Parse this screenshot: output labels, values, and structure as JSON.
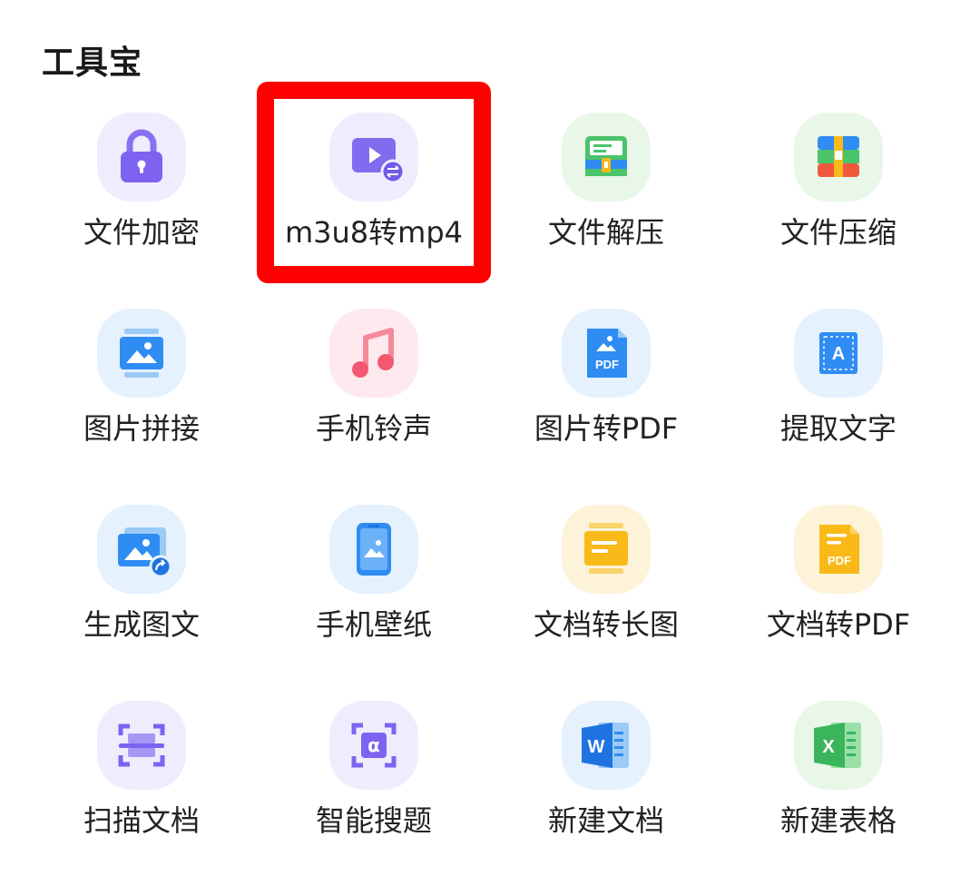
{
  "section": {
    "title": "工具宝"
  },
  "tools": [
    {
      "label": "文件加密",
      "icon": "lock-icon"
    },
    {
      "label": "m3u8转mp4",
      "icon": "video-convert-icon"
    },
    {
      "label": "文件解压",
      "icon": "archive-unzip-icon"
    },
    {
      "label": "文件压缩",
      "icon": "archive-zip-icon"
    },
    {
      "label": "图片拼接",
      "icon": "image-stitch-icon"
    },
    {
      "label": "手机铃声",
      "icon": "music-note-icon"
    },
    {
      "label": "图片转PDF",
      "icon": "image-to-pdf-icon"
    },
    {
      "label": "提取文字",
      "icon": "text-extract-icon"
    },
    {
      "label": "生成图文",
      "icon": "image-share-icon"
    },
    {
      "label": "手机壁纸",
      "icon": "phone-wallpaper-icon"
    },
    {
      "label": "文档转长图",
      "icon": "doc-to-long-image-icon"
    },
    {
      "label": "文档转PDF",
      "icon": "doc-to-pdf-icon"
    },
    {
      "label": "扫描文档",
      "icon": "scan-icon"
    },
    {
      "label": "智能搜题",
      "icon": "alpha-search-icon"
    },
    {
      "label": "新建文档",
      "icon": "word-doc-icon"
    },
    {
      "label": "新建表格",
      "icon": "excel-sheet-icon"
    }
  ],
  "icon_text": {
    "pdf": "PDF",
    "letter_a": "A",
    "alpha": "α",
    "word": "W",
    "excel": "X"
  },
  "colors": {
    "highlight": "#ff0000",
    "purple": "#7d63f0",
    "blue": "#2f8cf3",
    "green": "#4bc36b",
    "pink": "#f2586f",
    "yellow": "#f9b918"
  }
}
